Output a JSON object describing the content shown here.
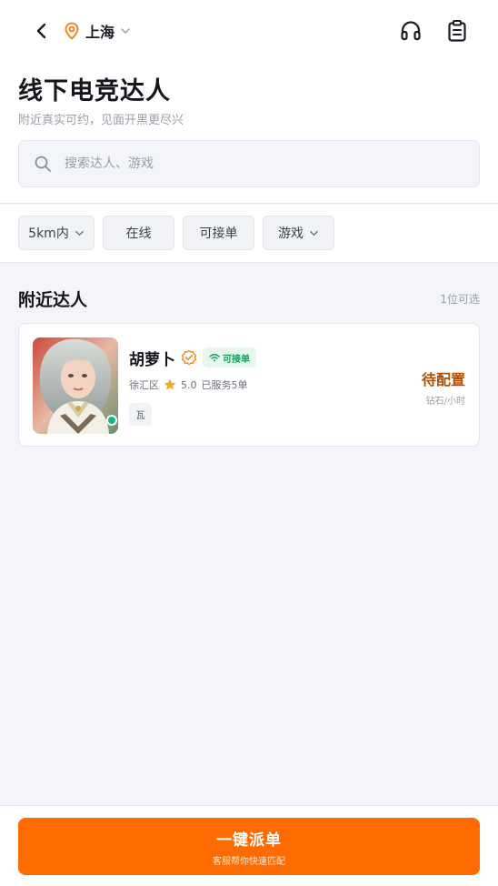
{
  "header": {
    "city": "上海",
    "title": "线下电竞达人",
    "subtitle": "附近真实可约，见面开黑更尽兴"
  },
  "search": {
    "placeholder": "搜索达人、游戏",
    "value": ""
  },
  "filters": [
    {
      "label": "5km内",
      "has_dropdown": true
    },
    {
      "label": "在线",
      "has_dropdown": false
    },
    {
      "label": "可接单",
      "has_dropdown": false
    },
    {
      "label": "游戏",
      "has_dropdown": true
    }
  ],
  "section": {
    "title": "附近达人",
    "count": "1位可选"
  },
  "providers": [
    {
      "name": "胡萝卜",
      "verified": true,
      "status_badge": "可接单",
      "district": "徐汇区",
      "rating": "5.0",
      "served": "已服务5单",
      "tag": "瓦",
      "price": "待配置",
      "price_unit": "钻石/小时",
      "online": true
    }
  ],
  "dispatch": {
    "label": "一键派单",
    "sub_label": "客服帮你快速匹配"
  },
  "colors": {
    "accent": "#ff6b00",
    "price": "#b34f00",
    "online": "#12b886",
    "badge_green": "#15a05b",
    "location_pin": "#ff7a00",
    "star": "#f5a623"
  },
  "icons": [
    "back-arrow-icon",
    "location-pin-icon",
    "chevron-down-icon",
    "headset-icon",
    "clipboard-icon",
    "search-icon",
    "verified-icon",
    "wifi-icon",
    "star-icon"
  ]
}
